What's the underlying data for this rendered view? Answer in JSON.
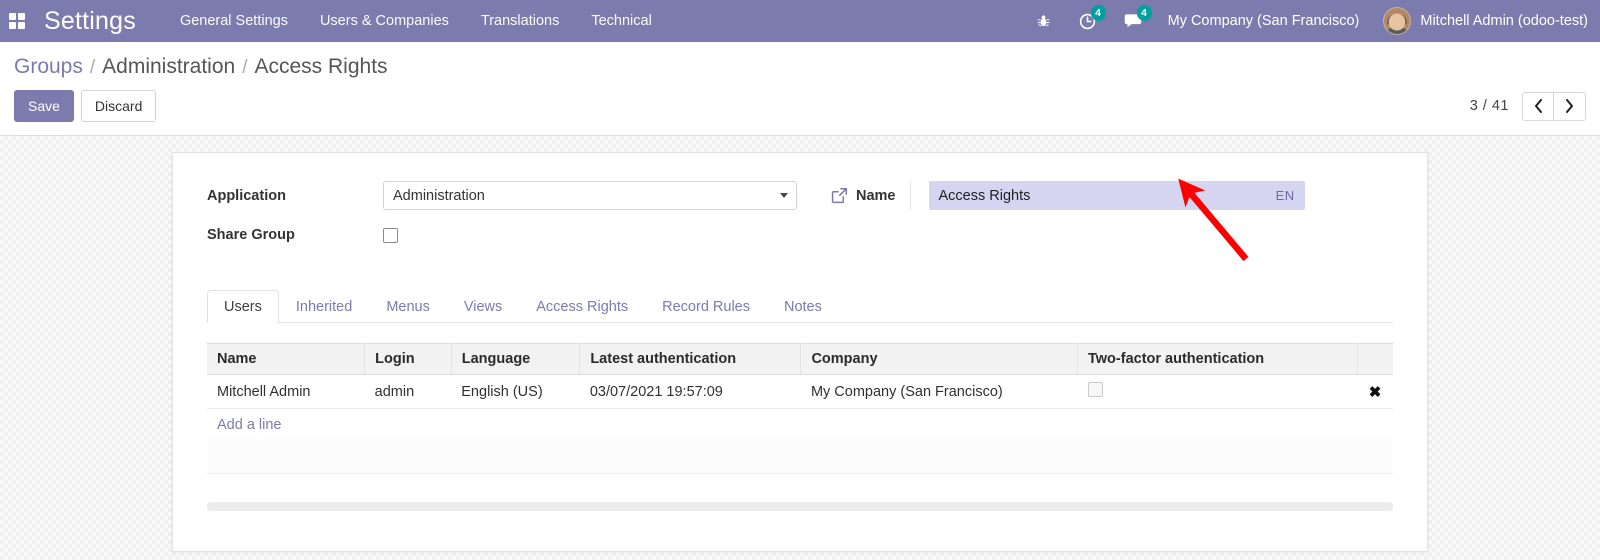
{
  "navbar": {
    "apps_icon": "apps-grid-icon",
    "brand": "Settings",
    "menu": [
      {
        "label": "General Settings"
      },
      {
        "label": "Users & Companies"
      },
      {
        "label": "Translations"
      },
      {
        "label": "Technical"
      }
    ],
    "icons": [
      {
        "name": "bug-icon",
        "badge": ""
      },
      {
        "name": "clock-activity-icon",
        "badge": "4"
      },
      {
        "name": "messages-icon",
        "badge": "4"
      }
    ],
    "company": "My Company (San Francisco)",
    "user": "Mitchell Admin (odoo-test)",
    "avatar_name": "user-avatar"
  },
  "breadcrumb": {
    "root": "Groups",
    "sep": "/",
    "parent": "Administration",
    "current": "Access Rights"
  },
  "controls": {
    "save_label": "Save",
    "discard_label": "Discard",
    "pager_value": "3 / 41",
    "prev_icon": "chevron-left-icon",
    "next_icon": "chevron-right-icon"
  },
  "form": {
    "application_label": "Application",
    "application_value": "Administration",
    "share_group_label": "Share Group",
    "share_group_checked": false,
    "name_label": "Name",
    "name_value": "Access Rights",
    "name_lang_badge": "EN",
    "external_link_icon": "external-link-icon"
  },
  "notebook": {
    "tabs": [
      {
        "label": "Users",
        "active": true
      },
      {
        "label": "Inherited",
        "active": false
      },
      {
        "label": "Menus",
        "active": false
      },
      {
        "label": "Views",
        "active": false
      },
      {
        "label": "Access Rights",
        "active": false
      },
      {
        "label": "Record Rules",
        "active": false
      },
      {
        "label": "Notes",
        "active": false
      }
    ]
  },
  "table": {
    "columns": [
      "Name",
      "Login",
      "Language",
      "Latest authentication",
      "Company",
      "Two-factor authentication"
    ],
    "rows": [
      {
        "name": "Mitchell Admin",
        "login": "admin",
        "language": "English (US)",
        "latest_authentication": "03/07/2021 19:57:09",
        "company": "My Company (San Francisco)",
        "two_factor": false,
        "delete_icon": "delete-row-icon"
      }
    ],
    "add_line_label": "Add a line"
  },
  "annotation": {
    "arrow_color": "#ff0000",
    "target": "name-lang-badge"
  },
  "colors": {
    "brand_purple": "#7c7bad",
    "badge_teal": "#00A09D",
    "highlight_lavender": "#d5d5f2",
    "arrow_red": "#ff0000"
  }
}
